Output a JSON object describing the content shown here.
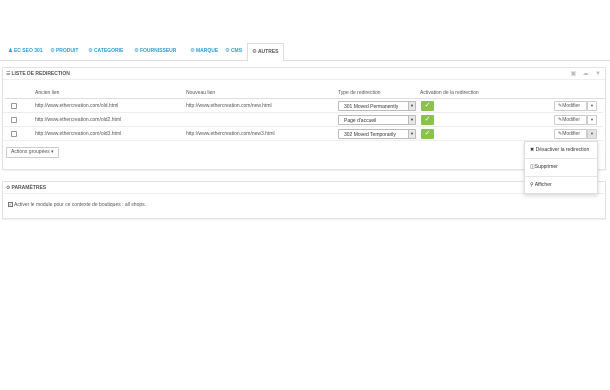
{
  "tabs": [
    {
      "label": "EC SEO 301",
      "icon": "user-icon"
    },
    {
      "label": "PRODUIT",
      "icon": "cogs-icon"
    },
    {
      "label": "CATEGORIE",
      "icon": "cogs-icon"
    },
    {
      "label": "FOURNISSEUR",
      "icon": "cogs-icon"
    },
    {
      "label": "MARQUE",
      "icon": "cogs-icon"
    },
    {
      "label": "CMS",
      "icon": "cogs-icon"
    },
    {
      "label": "AUTRES",
      "icon": "cogs-icon",
      "active": true
    }
  ],
  "list_panel": {
    "title": "LISTE DE REDIRECTION",
    "columns": {
      "old_link": "Ancien lien",
      "new_link": "Nouveau lien",
      "type": "Type de redirection",
      "activation": "Activation de la redirection"
    },
    "rows": [
      {
        "old": "http://www.ethercreation.com/old.html",
        "new": "http://www.ethercreation.com/new.html",
        "type": "301 Moved Permanently",
        "active": true,
        "action": "Modifier"
      },
      {
        "old": "http://www.ethercreation.com/old2.html",
        "new": "",
        "type": "Page d'accueil",
        "active": true,
        "action": "Modifier"
      },
      {
        "old": "http://www.ethercreation.com/old3.html",
        "new": "http://www.ethercreation.com/new3.html",
        "type": "302 Moved Temporarily",
        "active": true,
        "action": "Modifier"
      }
    ],
    "bulk_actions": "Actions groupées"
  },
  "row_menu": {
    "items": [
      {
        "label": "Désactiver la redirection",
        "icon": "times-icon"
      },
      {
        "label": "Supprimer",
        "icon": "trash-icon"
      },
      {
        "label": "Afficher",
        "icon": "zoom-icon"
      }
    ]
  },
  "params_panel": {
    "title": "PARAMÈTRES",
    "checkbox_label": "Activer le module pour ce contexte de boutiques : all shops."
  },
  "colors": {
    "accent": "#2b9ed8",
    "success": "#8bc34a",
    "border": "#e2e2e2"
  }
}
